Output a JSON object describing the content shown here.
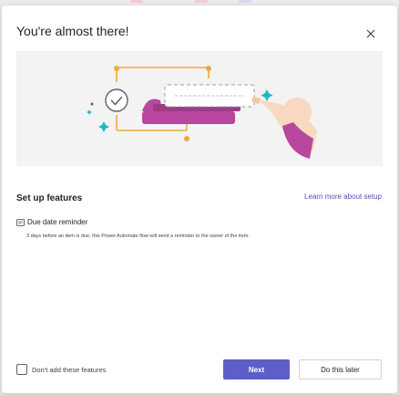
{
  "dialog": {
    "title": "You're almost there!",
    "close_icon": "close-icon"
  },
  "hero": {
    "icons": [
      "check-circle-icon",
      "sparkle-icon",
      "hand-icon",
      "flow-connector-icon"
    ]
  },
  "setup": {
    "section_title": "Set up features",
    "learn_more": "Learn more about setup",
    "features": [
      {
        "icon": "reminder-icon",
        "label": "Due date reminder",
        "description": "3 days before an item is due, this Power Automate flow will send a reminder to the owner of the item."
      }
    ]
  },
  "footer": {
    "skip_checkbox_label": "Don't add these features",
    "next_label": "Next",
    "later_label": "Do this later"
  },
  "colors": {
    "primary": "#5b5fc7",
    "link": "#4f52b2",
    "accent_purple": "#b8479d",
    "accent_orange": "#f2a93b",
    "accent_teal": "#1cb8c6"
  }
}
